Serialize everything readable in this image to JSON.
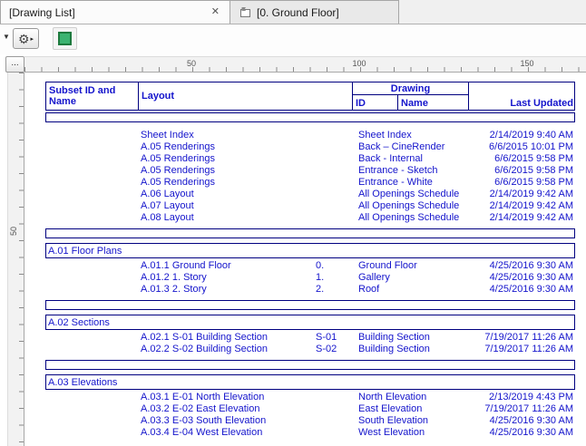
{
  "colors": {
    "table_text_blue": "#1414cc",
    "table_border_navy": "#000080",
    "green_button_fill": "#3cb371",
    "green_button_border": "#1d7a3e",
    "tabbar_background": "#f0f0f0"
  },
  "icons": {
    "gear": "⚙",
    "split_arrow": "▸",
    "collapse_arrow": "▼",
    "close": "✕",
    "overflow": "..."
  },
  "tabs": [
    {
      "label": "[Drawing List]"
    },
    {
      "label": "[0. Ground Floor]"
    }
  ],
  "rulers": {
    "horizontal_labels": [
      "50",
      "100",
      "150"
    ],
    "vertical_labels": [
      "50"
    ]
  },
  "table": {
    "headers": {
      "subset": "Subset ID and Name",
      "layout": "Layout",
      "drawing": "Drawing",
      "id": "ID",
      "name": "Name",
      "last_updated": "Last Updated"
    },
    "groups": [
      {
        "subset": "",
        "rows": [
          {
            "layout": "Sheet Index",
            "id": "",
            "name": "Sheet Index",
            "updated": "2/14/2019 9:40 AM"
          },
          {
            "layout": "A.05 Renderings",
            "id": "",
            "name": "Back – CineRender",
            "updated": "6/6/2015 10:01 PM"
          },
          {
            "layout": "A.05 Renderings",
            "id": "",
            "name": "Back - Internal",
            "updated": "6/6/2015 9:58 PM"
          },
          {
            "layout": "A.05 Renderings",
            "id": "",
            "name": "Entrance - Sketch",
            "updated": "6/6/2015 9:58 PM"
          },
          {
            "layout": "A.05 Renderings",
            "id": "",
            "name": "Entrance - White",
            "updated": "6/6/2015 9:58 PM"
          },
          {
            "layout": "A.06 Layout",
            "id": "",
            "name": "All Openings Schedule",
            "updated": "2/14/2019 9:42 AM"
          },
          {
            "layout": "A.07 Layout",
            "id": "",
            "name": "All Openings Schedule",
            "updated": "2/14/2019 9:42 AM"
          },
          {
            "layout": "A.08 Layout",
            "id": "",
            "name": "All Openings Schedule",
            "updated": "2/14/2019 9:42 AM"
          }
        ]
      },
      {
        "subset": "A.01 Floor Plans",
        "rows": [
          {
            "layout": "A.01.1 Ground Floor",
            "id": "0.",
            "name": "Ground Floor",
            "updated": "4/25/2016 9:30 AM"
          },
          {
            "layout": "A.01.2 1. Story",
            "id": "1.",
            "name": "Gallery",
            "updated": "4/25/2016 9:30 AM"
          },
          {
            "layout": "A.01.3 2. Story",
            "id": "2.",
            "name": "Roof",
            "updated": "4/25/2016 9:30 AM"
          }
        ]
      },
      {
        "subset": "A.02 Sections",
        "rows": [
          {
            "layout": "A.02.1 S-01 Building Section",
            "id": "S-01",
            "name": "Building Section",
            "updated": "7/19/2017 11:26 AM"
          },
          {
            "layout": "A.02.2 S-02 Building Section",
            "id": "S-02",
            "name": "Building Section",
            "updated": "7/19/2017 11:26 AM"
          }
        ]
      },
      {
        "subset": "A.03 Elevations",
        "rows": [
          {
            "layout": "A.03.1 E-01 North Elevation",
            "id": "",
            "name": "North Elevation",
            "updated": "2/13/2019 4:43 PM"
          },
          {
            "layout": "A.03.2 E-02 East Elevation",
            "id": "",
            "name": "East Elevation",
            "updated": "7/19/2017 11:26 AM"
          },
          {
            "layout": "A.03.3 E-03 South Elevation",
            "id": "",
            "name": "South Elevation",
            "updated": "4/25/2016 9:30 AM"
          },
          {
            "layout": "A.03.4 E-04 West Elevation",
            "id": "",
            "name": "West Elevation",
            "updated": "4/25/2016 9:30 AM"
          }
        ]
      }
    ]
  }
}
